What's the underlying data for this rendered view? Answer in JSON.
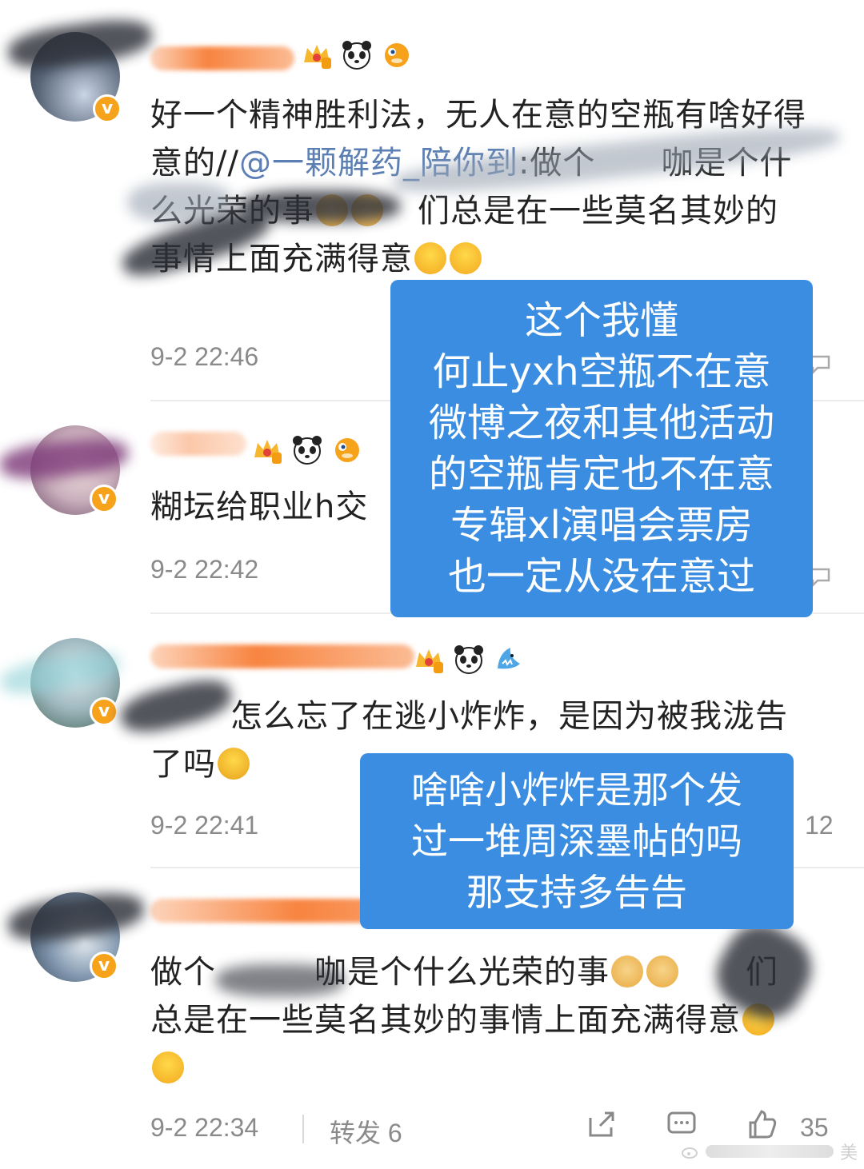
{
  "comments": [
    {
      "text_parts": [
        "好一个精神胜利法，无人在意的空瓶有啥好得意的//",
        "@一颗解药_陪你到",
        ":做个",
        "咖是个什么光荣的事",
        "",
        "们总是在一些莫名其妙的事情上面充满得意"
      ],
      "time": "9-2 22:46"
    },
    {
      "text_parts": [
        "糊坛给职业h交"
      ],
      "time": "9-2 22:42"
    },
    {
      "text_parts": [
        "怎么忘了在逃小炸炸，是因为被我泷告了吗"
      ],
      "time": "9-2 22:41",
      "right_count": "12"
    },
    {
      "text_parts": [
        "做个",
        "咖是个什么光荣的事",
        "",
        "们总是在一些莫名其妙的事情上面充满得意"
      ],
      "time": "9-2 22:34",
      "repost_label": "转发 6",
      "like_count": "35"
    }
  ],
  "overlays": [
    {
      "lines": [
        "这个我懂",
        "何止yxh空瓶不在意",
        "微博之夜和其他活动",
        "的空瓶肯定也不在意",
        "专辑xl演唱会票房",
        "也一定从没在意过"
      ]
    },
    {
      "lines": [
        "啥啥小炸炸是那个发",
        "过一堆周深墨帖的吗",
        "那支持多告告"
      ]
    }
  ],
  "colors": {
    "overlay_bg": "#3a8de0",
    "username_orange": "#f88440",
    "vip_badge": "#f7a21b",
    "timestamp_gray": "#8a8a8a"
  },
  "icons": [
    "crown-level-badge-icon",
    "panda-icon",
    "pufferfish-icon",
    "shark-icon",
    "doge-emoji-icon",
    "shrug-emoji-icon",
    "thinking-emoji-icon",
    "share-icon",
    "comment-icon",
    "like-icon"
  ],
  "watermark": "美"
}
